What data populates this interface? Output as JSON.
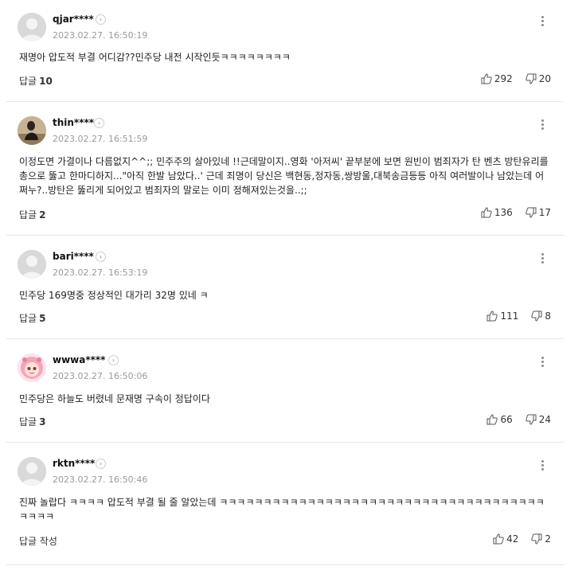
{
  "reply_label": "답글",
  "comments": [
    {
      "nickname": "qjar****",
      "time": "2023.02.27. 16:50:19",
      "text": "재명아 압도적 부결 어디감??민주당 내전 시작인듯ㅋㅋㅋㅋㅋㅋㅋㅋ",
      "reply_count": "10",
      "likes": "292",
      "dislikes": "20",
      "avatar": "default-avatar"
    },
    {
      "nickname": "thin****",
      "time": "2023.02.27. 16:51:59",
      "text": "이정도면 가결이나 다름없지^^;; 민주주의 살아있네 !!근데말이지..영화 '아저씨' 끝부분에 보면 원빈이 범죄자가 탄 벤츠 방탄유리를 총으로 뚫고 한마디하지...\"아직 한발 남았다..' 근데 죄명이 당신은 백현동,정자동,쌍방울,대북송금등등 아직 여러발이나 남았는데 어쩌누?..방탄은 뚫리게 되어있고 범죄자의 말로는 이미 정해져있는것을..;;",
      "reply_count": "2",
      "likes": "136",
      "dislikes": "17",
      "avatar": "photo-avatar"
    },
    {
      "nickname": "bari****",
      "time": "2023.02.27. 16:53:19",
      "text": "민주당 169명중 정상적인 대가리 32명 있네 ㅋ",
      "reply_count": "5",
      "likes": "111",
      "dislikes": "8",
      "avatar": "default-avatar"
    },
    {
      "nickname": "wwwa****",
      "time": "2023.02.27. 16:50:06",
      "text": "민주당은 하늘도 버렸네 문재명 구속이 정답이다",
      "reply_count": "3",
      "likes": "66",
      "dislikes": "24",
      "avatar": "cartoon-avatar"
    },
    {
      "nickname": "rktn****",
      "time": "2023.02.27. 16:50:46",
      "text": "진짜 놀랍다 ㅋㅋㅋㅋ 압도적 부결 될 줄 알았는데 ㅋㅋㅋㅋㅋㅋㅋㅋㅋㅋㅋㅋㅋㅋㅋㅋㅋㅋㅋㅋㅋㅋㅋㅋㅋㅋㅋㅋㅋㅋㅋㅋㅋㅋㅋㅋㅋㅋㅋㅋㅋ",
      "reply_write_label": "답글 작성",
      "likes": "42",
      "dislikes": "2",
      "avatar": "default-avatar"
    }
  ]
}
